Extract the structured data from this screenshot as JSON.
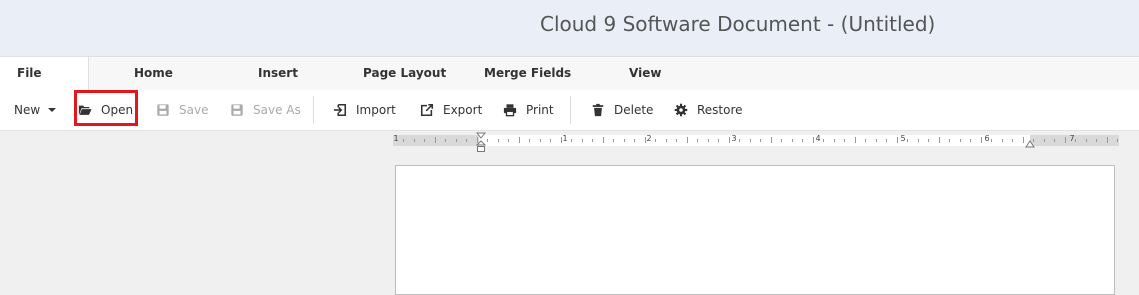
{
  "app": {
    "title": "Cloud 9 Software Document - (Untitled)"
  },
  "tabs": [
    {
      "label": "File",
      "active": true
    },
    {
      "label": "Home"
    },
    {
      "label": "Insert"
    },
    {
      "label": "Page Layout"
    },
    {
      "label": "Merge Fields"
    },
    {
      "label": "View"
    }
  ],
  "toolbar": {
    "new_label": "New",
    "open_label": "Open",
    "save_label": "Save",
    "save_as_label": "Save As",
    "import_label": "Import",
    "export_label": "Export",
    "print_label": "Print",
    "delete_label": "Delete",
    "restore_label": "Restore"
  },
  "ruler": {
    "labels": [
      "1",
      "1",
      "2",
      "3",
      "4",
      "5",
      "6",
      "7"
    ]
  },
  "colors": {
    "highlight": "#e3161e",
    "titlebar": "#e9eef7"
  }
}
